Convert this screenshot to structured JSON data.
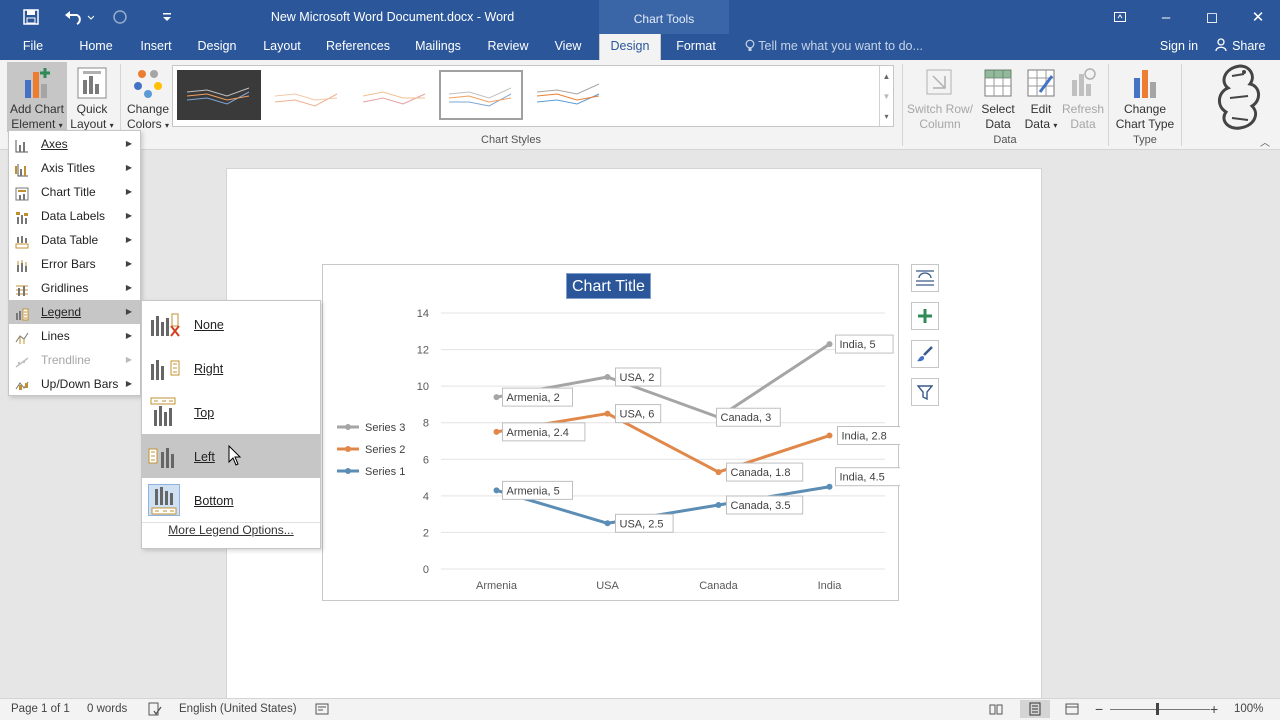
{
  "window": {
    "title": "New Microsoft Word Document.docx - Word",
    "contextual_group": "Chart Tools",
    "controls": {
      "ribbon_display_icon": "ribbon-display-icon",
      "minimize": "–",
      "restore": "◻",
      "close": "✕"
    }
  },
  "quick_access": {
    "save_icon": "save-icon",
    "undo_icon": "undo-icon",
    "redo_icon": "redo-icon",
    "customize_icon": "customize-icon"
  },
  "tabs": [
    {
      "label": "File"
    },
    {
      "label": "Home"
    },
    {
      "label": "Insert"
    },
    {
      "label": "Design"
    },
    {
      "label": "Layout"
    },
    {
      "label": "References"
    },
    {
      "label": "Mailings"
    },
    {
      "label": "Review"
    },
    {
      "label": "View"
    },
    {
      "label": "Design",
      "active": true
    },
    {
      "label": "Format"
    }
  ],
  "tell_me": "Tell me what you want to do...",
  "account": {
    "sign_in": "Sign in",
    "share": "Share"
  },
  "ribbon": {
    "add_chart_element": {
      "line1": "Add Chart",
      "line2": "Element"
    },
    "quick_layout": {
      "line1": "Quick",
      "line2": "Layout"
    },
    "change_colors": {
      "line1": "Change",
      "line2": "Colors"
    },
    "chart_styles_label": "Chart Styles",
    "switch_row_column": {
      "line1": "Switch Row/",
      "line2": "Column"
    },
    "select_data": {
      "line1": "Select",
      "line2": "Data"
    },
    "edit_data": {
      "line1": "Edit",
      "line2": "Data"
    },
    "refresh_data": {
      "line1": "Refresh",
      "line2": "Data"
    },
    "data_label": "Data",
    "change_chart_type": {
      "line1": "Change",
      "line2": "Chart Type"
    },
    "type_label": "Type"
  },
  "chart_elements_menu": [
    {
      "label": "Axes",
      "icon": "axes-icon"
    },
    {
      "label": "Axis Titles",
      "icon": "axis-titles-icon"
    },
    {
      "label": "Chart Title",
      "icon": "chart-title-icon"
    },
    {
      "label": "Data Labels",
      "icon": "data-labels-icon"
    },
    {
      "label": "Data Table",
      "icon": "data-table-icon"
    },
    {
      "label": "Error Bars",
      "icon": "error-bars-icon"
    },
    {
      "label": "Gridlines",
      "icon": "gridlines-icon"
    },
    {
      "label": "Legend",
      "icon": "legend-icon",
      "highlighted": true
    },
    {
      "label": "Lines",
      "icon": "lines-icon"
    },
    {
      "label": "Trendline",
      "icon": "trendline-icon",
      "disabled": true
    },
    {
      "label": "Up/Down Bars",
      "icon": "up-down-bars-icon"
    }
  ],
  "legend_submenu": {
    "items": [
      {
        "label": "None"
      },
      {
        "label": "Right"
      },
      {
        "label": "Top"
      },
      {
        "label": "Left",
        "hover": true
      },
      {
        "label": "Bottom",
        "selected": true
      }
    ],
    "more": "More Legend Options..."
  },
  "chart_side_buttons": [
    "layout-options-icon",
    "chart-elements-plus-icon",
    "chart-styles-brush-icon",
    "chart-filters-icon"
  ],
  "chart_data": {
    "type": "line",
    "title": "Chart Title",
    "categories": [
      "Armenia",
      "USA",
      "Canada",
      "India"
    ],
    "ylim": [
      0,
      14
    ],
    "yticks": [
      0,
      2,
      4,
      6,
      8,
      10,
      12,
      14
    ],
    "grid": true,
    "legend_position": "left",
    "series": [
      {
        "name": "Series 1",
        "values": [
          4.3,
          2.5,
          3.5,
          4.5
        ],
        "labels": [
          "Armenia, 5",
          "USA, 2.5",
          "Canada, 3.5",
          "India, 4.5"
        ],
        "color": "#5b8db5"
      },
      {
        "name": "Series 2",
        "values": [
          7.5,
          8.5,
          5.3,
          7.3
        ],
        "labels": [
          "Armenia, 2.4",
          "USA, 6",
          "Canada, 1.8",
          "India, 2.8"
        ],
        "color": "#e0884a"
      },
      {
        "name": "Series 3",
        "values": [
          9.4,
          10.5,
          8.3,
          12.3
        ],
        "labels": [
          "Armenia, 2",
          "USA, 2",
          "Canada, 3",
          "India, 5"
        ],
        "color": "#a5a5a5"
      }
    ]
  },
  "status": {
    "page": "Page 1 of 1",
    "words": "0 words",
    "language": "English (United States)",
    "zoom": "100%"
  }
}
